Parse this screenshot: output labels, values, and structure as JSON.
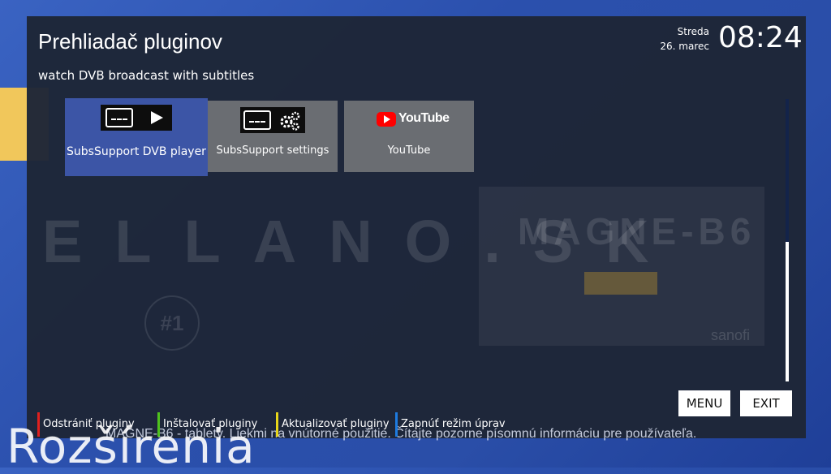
{
  "background": {
    "bottom_text": "Rozšírenia",
    "subtitle_line": "MAGNE-B6 - tablety. Liekmi na vnútorné použitie. Čítajte pozorne písomnú informáciu pre používateľa.",
    "watermark": "ELLANO.SK",
    "pack_brand": "MAGNE-B6",
    "pack_logo": "sanofi",
    "badge": "#1"
  },
  "header": {
    "title": "Prehliadač pluginov",
    "subtitle": "watch DVB broadcast with subtitles",
    "day": "Streda",
    "date": "26. marec",
    "time": "08:24"
  },
  "plugins": [
    {
      "label": "SubsSupport DVB player",
      "icon": "subtitles-play-icon",
      "selected": true
    },
    {
      "label": "SubsSupport settings",
      "icon": "subtitles-gear-icon",
      "selected": false
    },
    {
      "label": "YouTube",
      "icon": "youtube-logo-icon",
      "logo_text": "YouTube",
      "selected": false
    }
  ],
  "buttons": {
    "menu": "MENU",
    "exit": "EXIT"
  },
  "footer": [
    {
      "label": "Odstrániť pluginy",
      "color": "#e0201e"
    },
    {
      "label": "Inštalovať pluginy",
      "color": "#4fc21e"
    },
    {
      "label": "Aktualizovať pluginy",
      "color": "#e8d61a"
    },
    {
      "label": "Zapnúť režim úprav",
      "color": "#1e7be0"
    }
  ],
  "colors": {
    "panel": "#1e2637",
    "selected_tile": "#3c55a6",
    "tile": "#6a6d72",
    "youtube_red": "#ff0000"
  }
}
